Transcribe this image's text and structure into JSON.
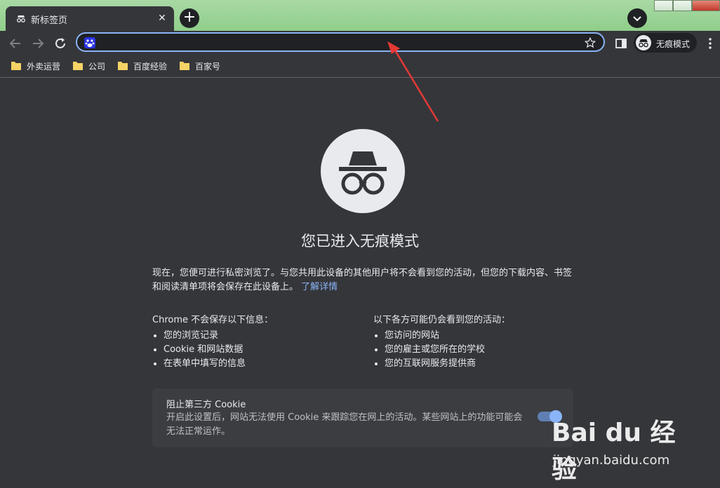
{
  "tab": {
    "title": "新标签页",
    "icon": "incognito-icon",
    "close": "✕"
  },
  "new_tab": "+",
  "toolbar": {
    "url_value": "",
    "incognito_label": "无痕模式"
  },
  "bookmarks": [
    {
      "label": "外卖运营",
      "icon": "folder-icon"
    },
    {
      "label": "公司",
      "icon": "folder-icon"
    },
    {
      "label": "百度经验",
      "icon": "folder-icon"
    },
    {
      "label": "百家号",
      "icon": "folder-icon"
    }
  ],
  "page": {
    "heading": "您已进入无痕模式",
    "intro": "现在，您便可进行私密浏览了。与您共用此设备的其他用户将不会看到您的活动，但您的下载内容、书签和阅读清单项将会保存在此设备上。",
    "learn_more": "了解详情",
    "left_col": {
      "title": "Chrome 不会保存以下信息：",
      "items": [
        "您的浏览记录",
        "Cookie 和网站数据",
        "在表单中填写的信息"
      ]
    },
    "right_col": {
      "title": "以下各方可能仍会看到您的活动：",
      "items": [
        "您访问的网站",
        "您的雇主或您所在的学校",
        "您的互联网服务提供商"
      ]
    },
    "cookie": {
      "title": "阻止第三方 Cookie",
      "desc": "开启此设置后，网站无法使用 Cookie 来跟踪您在网上的活动。某些网站上的功能可能会无法正常运作。",
      "enabled": true
    }
  },
  "watermark": {
    "logo": "Bai du 经验",
    "url": "jingyan.baidu.com"
  },
  "colors": {
    "accent": "#8ab4f8",
    "background": "#35363a",
    "annotation_arrow": "#e53935"
  }
}
